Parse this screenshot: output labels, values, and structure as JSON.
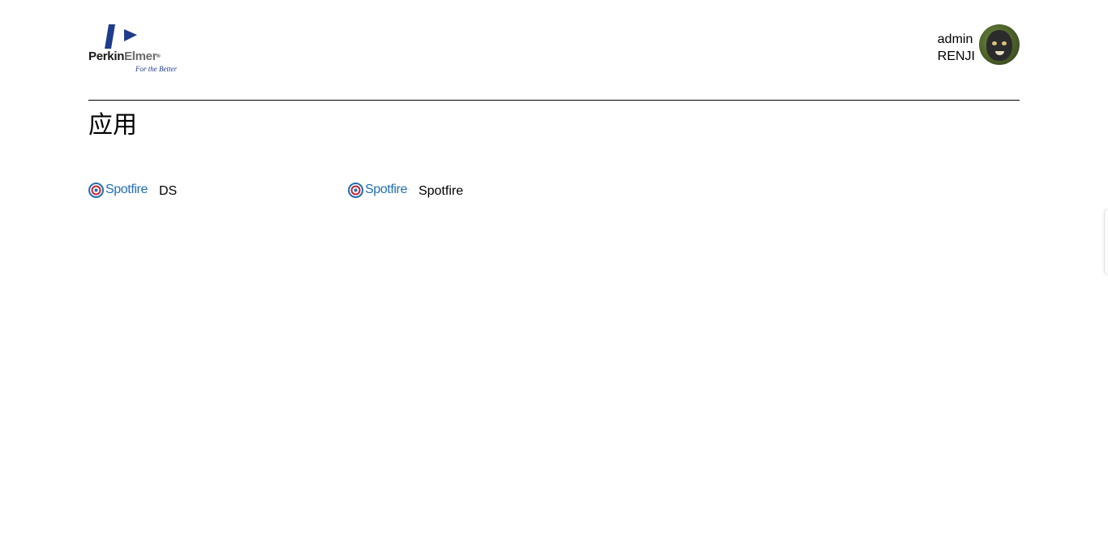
{
  "brand": {
    "name_part1": "Perkin",
    "name_part2": "Elmer",
    "registered": "®",
    "tagline": "For the Better",
    "colors": {
      "primary": "#1f3b8c",
      "dark": "#1a1a1a",
      "grey": "#6a6a6a"
    }
  },
  "user": {
    "username": "admin",
    "org": "RENJI",
    "avatar_icon": "monkey-avatar"
  },
  "page": {
    "title": "应用"
  },
  "apps": [
    {
      "brand_text": "Spotfire",
      "brand_tm": "·",
      "label": "DS",
      "icon": "spotfire-target-icon"
    },
    {
      "brand_text": "Spotfire",
      "brand_tm": "·",
      "label": "Spotfire",
      "icon": "spotfire-target-icon"
    }
  ],
  "colors": {
    "spotfire_blue": "#1f6fb2",
    "spotfire_red": "#c8202f",
    "divider": "#000000"
  }
}
